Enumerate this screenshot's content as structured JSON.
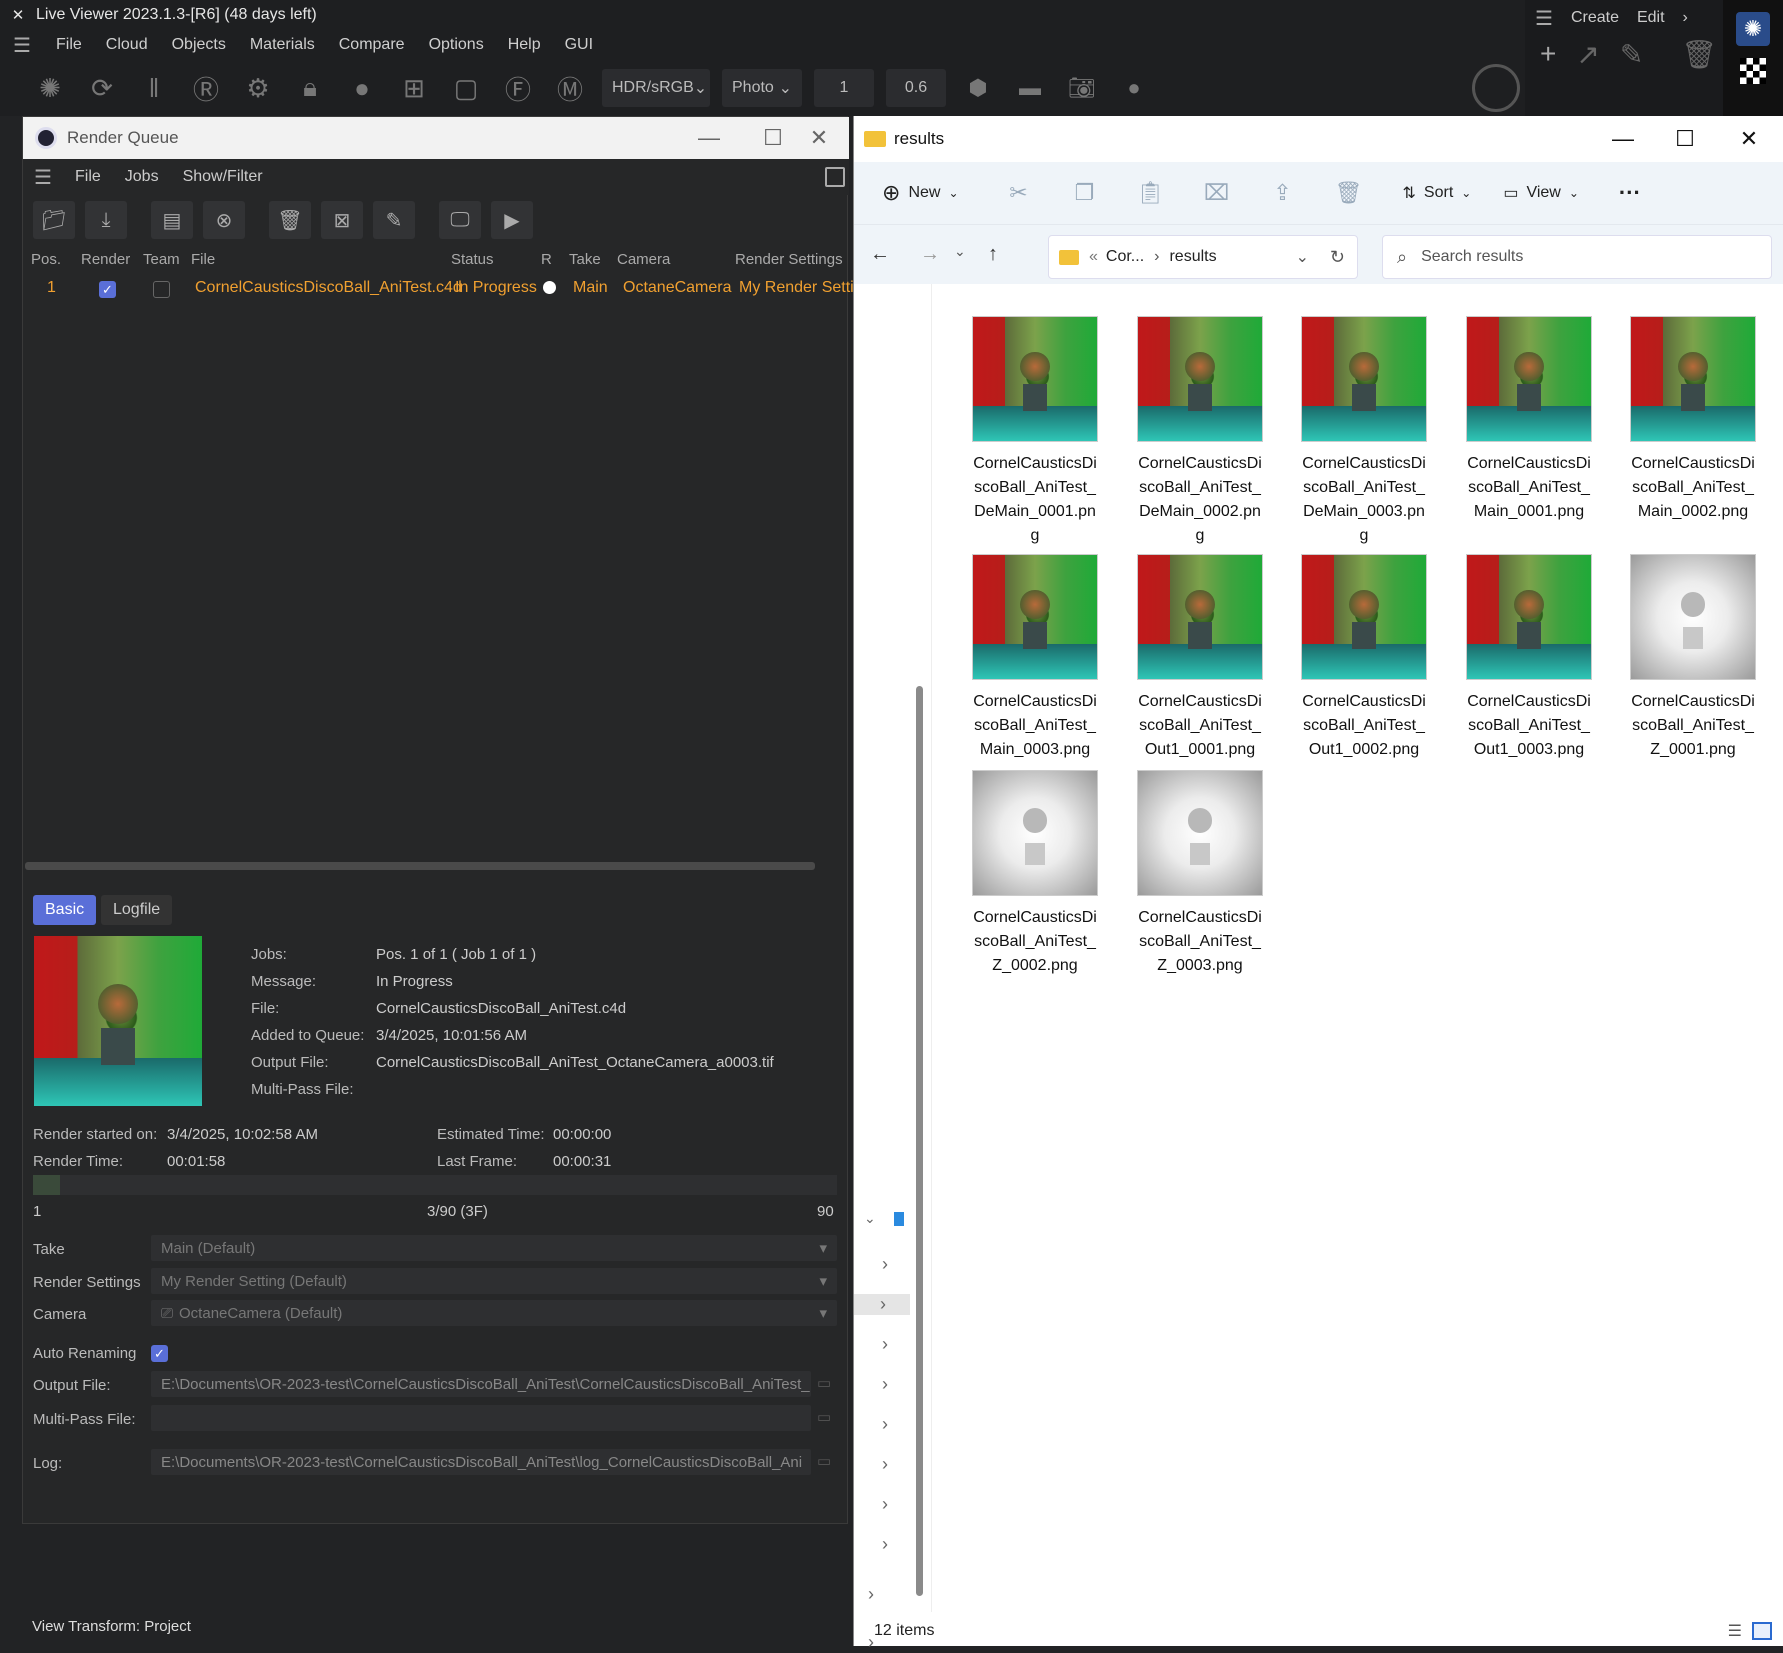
{
  "live_viewer": {
    "close_glyph": "✕",
    "title": "Live Viewer 2023.1.3-[R6] (48 days left)",
    "menu": [
      "File",
      "Cloud",
      "Objects",
      "Materials",
      "Compare",
      "Options",
      "Help",
      "GUI"
    ],
    "color_space": "HDR/sRGB",
    "tone": "Photo",
    "value1": "1",
    "value2": "0.6"
  },
  "c4d_menu": {
    "create": "Create",
    "edit": "Edit"
  },
  "render_queue": {
    "title": "Render Queue",
    "menu": [
      "File",
      "Jobs",
      "Show/Filter"
    ],
    "columns": [
      "Pos.",
      "Render",
      "Team",
      "File",
      "Status",
      "R",
      "Take",
      "Camera",
      "Render Settings"
    ],
    "row": {
      "pos": "1",
      "file": "CornelCausticsDiscoBall_AniTest.c4d",
      "status": "In Progress",
      "take": "Main",
      "camera": "OctaneCamera",
      "render_settings": "My Render Setti"
    },
    "tabs": [
      "Basic",
      "Logfile"
    ],
    "info": {
      "jobs_label": "Jobs:",
      "jobs": "Pos. 1 of 1 ( Job 1 of 1 )",
      "message_label": "Message:",
      "message": "In Progress",
      "file_label": "File:",
      "file": "CornelCausticsDiscoBall_AniTest.c4d",
      "added_label": "Added to Queue:",
      "added": "3/4/2025, 10:01:56 AM",
      "output_label": "Output File:",
      "output": "CornelCausticsDiscoBall_AniTest_OctaneCamera_a0003.tif",
      "multipass_label": "Multi-Pass File:"
    },
    "timing": {
      "started_label": "Render started on:",
      "started": "3/4/2025, 10:02:58 AM",
      "estimated_label": "Estimated Time:",
      "estimated": "00:00:00",
      "render_time_label": "Render Time:",
      "render_time": "00:01:58",
      "last_frame_label": "Last Frame:",
      "last_frame": "00:00:31"
    },
    "progress": {
      "start": "1",
      "current": "3/90 (3F)",
      "end": "90",
      "fraction": 0.033
    },
    "settings": {
      "take_label": "Take",
      "take": "Main (Default)",
      "rs_label": "Render Settings",
      "rs": "My Render Setting (Default)",
      "camera_label": "Camera",
      "camera": "OctaneCamera (Default)",
      "auto_label": "Auto Renaming",
      "output_label": "Output File:",
      "output": "E:\\Documents\\OR-2023-test\\CornelCausticsDiscoBall_AniTest\\CornelCausticsDiscoBall_AniTest_",
      "multipass_label": "Multi-Pass File:",
      "log_label": "Log:",
      "log": "E:\\Documents\\OR-2023-test\\CornelCausticsDiscoBall_AniTest\\log_CornelCausticsDiscoBall_Ani"
    }
  },
  "explorer": {
    "title": "results",
    "commands": {
      "new": "New",
      "sort": "Sort",
      "view": "View",
      "more": "···"
    },
    "breadcrumb": {
      "parent": "Cor...",
      "current": "results"
    },
    "search_placeholder": "Search results",
    "files": [
      {
        "l1": "CornelCausticsDi",
        "l2": "scoBall_AniTest_",
        "l3": "DeMain_0001.pn",
        "l4": "g",
        "kind": "color"
      },
      {
        "l1": "CornelCausticsDi",
        "l2": "scoBall_AniTest_",
        "l3": "DeMain_0002.pn",
        "l4": "g",
        "kind": "color"
      },
      {
        "l1": "CornelCausticsDi",
        "l2": "scoBall_AniTest_",
        "l3": "DeMain_0003.pn",
        "l4": "g",
        "kind": "color"
      },
      {
        "l1": "CornelCausticsDi",
        "l2": "scoBall_AniTest_",
        "l3": "Main_0001.png",
        "l4": "",
        "kind": "color"
      },
      {
        "l1": "CornelCausticsDi",
        "l2": "scoBall_AniTest_",
        "l3": "Main_0002.png",
        "l4": "",
        "kind": "color"
      },
      {
        "l1": "CornelCausticsDi",
        "l2": "scoBall_AniTest_",
        "l3": "Main_0003.png",
        "l4": "",
        "kind": "color"
      },
      {
        "l1": "CornelCausticsDi",
        "l2": "scoBall_AniTest_",
        "l3": "Out1_0001.png",
        "l4": "",
        "kind": "color"
      },
      {
        "l1": "CornelCausticsDi",
        "l2": "scoBall_AniTest_",
        "l3": "Out1_0002.png",
        "l4": "",
        "kind": "color"
      },
      {
        "l1": "CornelCausticsDi",
        "l2": "scoBall_AniTest_",
        "l3": "Out1_0003.png",
        "l4": "",
        "kind": "color"
      },
      {
        "l1": "CornelCausticsDi",
        "l2": "scoBall_AniTest_",
        "l3": "Z_0001.png",
        "l4": "",
        "kind": "gray"
      },
      {
        "l1": "CornelCausticsDi",
        "l2": "scoBall_AniTest_",
        "l3": "Z_0002.png",
        "l4": "",
        "kind": "gray"
      },
      {
        "l1": "CornelCausticsDi",
        "l2": "scoBall_AniTest_",
        "l3": "Z_0003.png",
        "l4": "",
        "kind": "gray"
      }
    ],
    "status": "12 items"
  },
  "view_transform": "View Transform: Project"
}
